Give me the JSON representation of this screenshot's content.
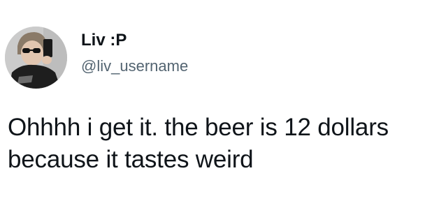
{
  "author": {
    "display_name": "Liv :P",
    "handle": "@liv_username",
    "avatar_icon": "avatar-selfie-photo"
  },
  "tweet": {
    "text": "Ohhhh i get it. the beer is 12 dollars\nbecause it tastes weird"
  },
  "colors": {
    "text": "#0f1419",
    "secondary_text": "#536471",
    "background": "#ffffff"
  }
}
